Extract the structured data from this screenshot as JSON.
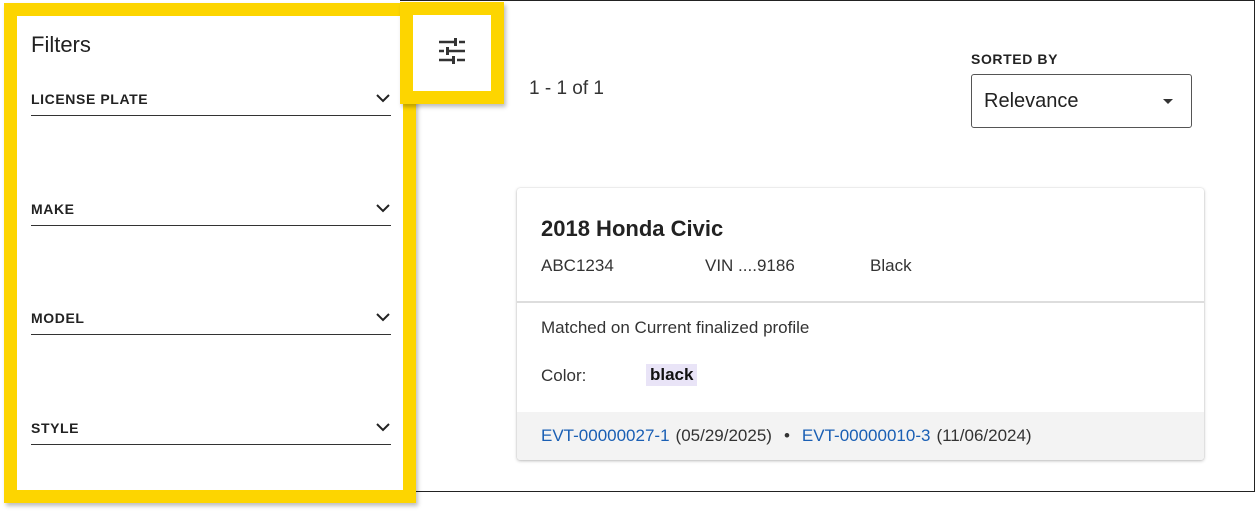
{
  "filters": {
    "title": "Filters",
    "items": [
      {
        "label": "LICENSE PLATE"
      },
      {
        "label": "MAKE"
      },
      {
        "label": "MODEL"
      },
      {
        "label": "STYLE"
      }
    ]
  },
  "toolbar": {
    "tune_icon": "tune-icon"
  },
  "results": {
    "count": "1 - 1 of 1",
    "sort": {
      "label": "SORTED BY",
      "value": "Relevance"
    }
  },
  "card": {
    "title": "2018 Honda Civic",
    "plate": "ABC1234",
    "vin": "VIN ....9186",
    "color": "Black",
    "matched": "Matched on Current finalized profile",
    "color_label": "Color:",
    "color_value": "black",
    "events": [
      {
        "id": "EVT-00000027-1",
        "date": "(05/29/2025)"
      },
      {
        "id": "EVT-00000010-3",
        "date": "(11/06/2024)"
      }
    ],
    "separator": "•"
  },
  "colors": {
    "highlight": "#fdd500",
    "link": "#1a5fb4",
    "chip": "#e9e4f7"
  }
}
